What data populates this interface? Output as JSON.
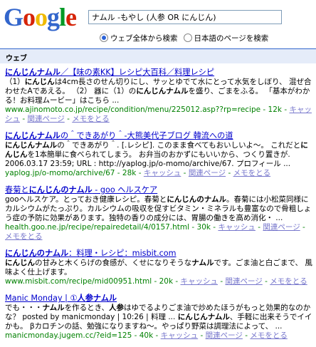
{
  "logo": {
    "letters": [
      {
        "ch": "G",
        "color": "#3366cc"
      },
      {
        "ch": "o",
        "color": "#d62408"
      },
      {
        "ch": "o",
        "color": "#efba00"
      },
      {
        "ch": "g",
        "color": "#3366cc"
      },
      {
        "ch": "l",
        "color": "#009925"
      },
      {
        "ch": "e",
        "color": "#d62408"
      }
    ]
  },
  "search": {
    "value": "ナムル -もやし (人参 OR にんじん)"
  },
  "radios": [
    {
      "label": "ウェブ全体から検索",
      "checked": true
    },
    {
      "label": "日本語のページを検索",
      "checked": false
    }
  ],
  "web_label": "ウェブ",
  "results": [
    {
      "title": "<b>にんじんナムル</b>／【味の素KK】レシピ大百科／料理レシピ",
      "snippet": "（1）<b>にんじん</b>は4cm長さのせん切りにし、サッとゆでて水にとって水気をしぼり、 混ぜ合わせたAであえる。 （2） 器に（1）の<b>にんじんナムル</b>を盛り、ごまをふる。 「基本がわかる！お料理ムービー」はこちら ...",
      "url": "www.ajinomoto.co.jp/recipe/condition/menu/225012.asp??rp=recipe - 12k -",
      "links": [
        "キャッシュ",
        "関連ページ",
        "メモをとる"
      ]
    },
    {
      "title": "<b>にんじんナムル</b>の＾できあがり＾-大熊美代子ブログ 韓流への道",
      "snippet": "<b>にんじんナムル</b>の＾できあがり＾. [.レシピ]. このまま食べてもおいしいよ〜。 これだと<b>にんじん</b>を1本簡単に食べられてしまう。 お弁当のおかずにもいいから、つくり置きが. 2006.03.17 23:59; URL : http://yaplog.jp/o-momo/archive/67. プロフィール ...",
      "url": "yaplog.jp/o-momo/archive/67 - 28k -",
      "links": [
        "キャッシュ",
        "関連ページ",
        "メモをとる"
      ]
    },
    {
      "title": "春菊と<b>にんじんのナムル</b> - goo ヘルスケア",
      "snippet": "gooヘルスケア。とっておき健康レシピ。春菊と<b>にんじんのナムル</b>。春菊には小松菜同様にカルシウムがたっぷり。カルシウムの吸収を促すビタミン・ミネラルも豊富なので骨粗しょう症の予防に効果があります。独特の香りの成分には、胃腸の働きを高め消化・ ...",
      "url": "health.goo.ne.jp/recipe/repairedetail/4/0157.html - 30k -",
      "links": [
        "キャッシュ",
        "関連ページ",
        "メモをとる"
      ]
    },
    {
      "title": "<b>にんじんのナムル</b>：料理・レシピ：misbit.com",
      "snippet": "<b>にんじん</b>の甘みと木くらげの食感が、くせになりそうな<b>ナムル</b>です。ごま油と白ごまで、 風味よく仕上げます。",
      "url": "www.misbit.com/recipe/mid00951.html - 20k -",
      "links": [
        "キャッシュ",
        "関連ページ",
        "メモをとる"
      ]
    },
    {
      "title": "Manic Monday | ①<b>人参ナムル</b>",
      "snippet": "でも・・・<b>ナムル</b>を作るとき、<b>人参</b>はゆでるよりごま油で炒めたほうがもっと効果的なのかな？ posted by manicmonday | 10:26 | 料理 ... <b>にんじんナムル</b>、手軽に出来そうでイイかも。 βカロチンの話、勉強になりますね〜。やっぱり野菜は調理法によって、 ...",
      "url": "manicmonday.jugem.cc/?eid=125 - 40k -",
      "links": [
        "キャッシュ",
        "関連ページ",
        "メモをとる"
      ]
    }
  ]
}
